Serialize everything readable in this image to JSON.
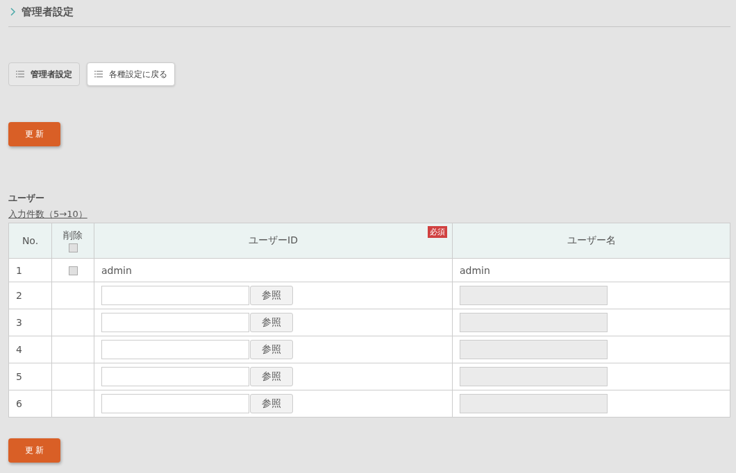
{
  "page_title": "管理者設定",
  "nav": [
    {
      "label": "管理者設定",
      "selected": true
    },
    {
      "label": "各種設定に戻る",
      "selected": false
    }
  ],
  "update_button": "更 新",
  "section_title": "ユーザー",
  "count_link": "入力件数（5→10）",
  "table": {
    "columns": {
      "no": "No.",
      "delete": "削除",
      "user_id": "ユーザーID",
      "required_badge": "必須",
      "user_name": "ユーザー名"
    },
    "header_delete_checked": false,
    "rows": [
      {
        "no": "1",
        "kind": "existing",
        "checked": false,
        "user_id": "admin",
        "user_name": "admin"
      },
      {
        "no": "2",
        "kind": "new",
        "browse_button": "参照"
      },
      {
        "no": "3",
        "kind": "new",
        "browse_button": "参照"
      },
      {
        "no": "4",
        "kind": "new",
        "browse_button": "参照"
      },
      {
        "no": "5",
        "kind": "new",
        "browse_button": "参照"
      },
      {
        "no": "6",
        "kind": "new",
        "browse_button": "参照"
      }
    ]
  },
  "bottom_update_button": "更 新"
}
